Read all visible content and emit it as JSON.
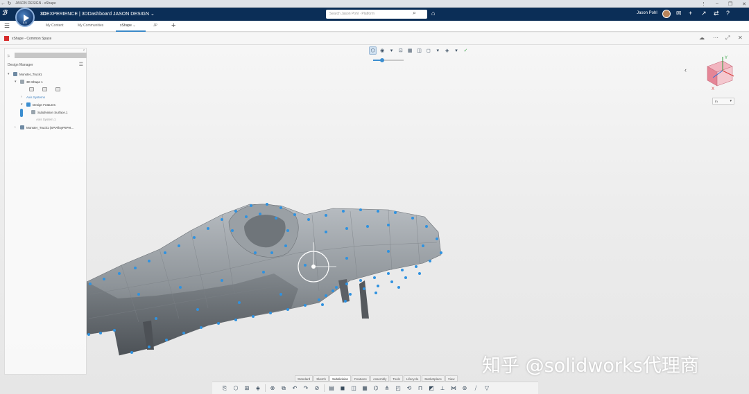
{
  "browser": {
    "title": "JASON DESIGN - xShape",
    "back_glyph": "←",
    "refresh_glyph": "↻",
    "minimize_glyph": "–",
    "restore_glyph": "❐",
    "close_glyph": "✕",
    "more_glyph": "⋮"
  },
  "topbar": {
    "brand_prefix": "3D",
    "brand_main": "EXPERIENCE | 3DDashboard",
    "tenant": "JASON DESIGN ⌄",
    "search_placeholder": "Search Jason Pohl · Platform",
    "search_glyph": "⌕",
    "tag_glyph": "⌂",
    "user_name": "Jason Pohl",
    "compass_version": "5.5",
    "ds_glyph": "ℬ",
    "icons": {
      "chat": "✉",
      "add": "+",
      "share": "↗",
      "apps": "⇄",
      "help": "?"
    }
  },
  "dashboard_tabs": {
    "menu_glyph": "☰",
    "items": [
      "My Content",
      "My Communities",
      "xShape  ⌄",
      "JP"
    ],
    "add_glyph": "+"
  },
  "appbar": {
    "title": "xShape - Common Space",
    "icons": {
      "cloud": "☁",
      "more": "⋯",
      "expand": "⤢",
      "close": "✕"
    }
  },
  "design_manager": {
    "close_glyph": "‹",
    "tree_glyph": "⊧",
    "title": "Design Manager",
    "menu_glyph": "☰",
    "tree": [
      {
        "label": "Monster_Truck1",
        "arrow": "▾"
      },
      {
        "label": "3D Shape 1",
        "arrow": "▾"
      },
      {
        "label": "Axis Systems",
        "arrow": "›"
      },
      {
        "label": "Design Features",
        "arrow": "▾"
      },
      {
        "label": "Subdivision Surface.1",
        "arrow": ""
      },
      {
        "label": "Axis System.1",
        "arrow": ""
      },
      {
        "label": "Monster_Truck1 (SPIAlloyP5Pet...",
        "arrow": "›"
      }
    ]
  },
  "top_tools": [
    "⬡",
    "◉",
    "▾",
    "⊡",
    "▦",
    "◫",
    "◻",
    "▾",
    "◈",
    "▾",
    "✓"
  ],
  "zoom": {
    "value": 0.3
  },
  "view_cube": {
    "axis_y": "Y",
    "axis_x": "X"
  },
  "unit_select": {
    "value": "In",
    "caret": "▾"
  },
  "collapse_glyph": "‹",
  "bottom_tabs": [
    "Standard",
    "Sketch",
    "Subdivision",
    "Features",
    "Assembly",
    "Tools",
    "Lifecycle",
    "Marketplace",
    "View"
  ],
  "active_bottom_tab": "Subdivision",
  "bottom_tools": [
    "⎘",
    "⬡",
    "⊞",
    "◈",
    "⊗",
    "⧉",
    "↶",
    "↷",
    "⊘",
    "▤",
    "◼",
    "◫",
    "▦",
    "⌬",
    "⋔",
    "◰",
    "⟲",
    "⊓",
    "◩",
    "⟂",
    "⋈",
    "⊛",
    "⧸",
    "▽"
  ],
  "watermark": "知乎 @solidworks代理商",
  "colors": {
    "topbar": "#0b2e57",
    "accent": "#3b8ed0",
    "body_shade": "#8a9096"
  }
}
